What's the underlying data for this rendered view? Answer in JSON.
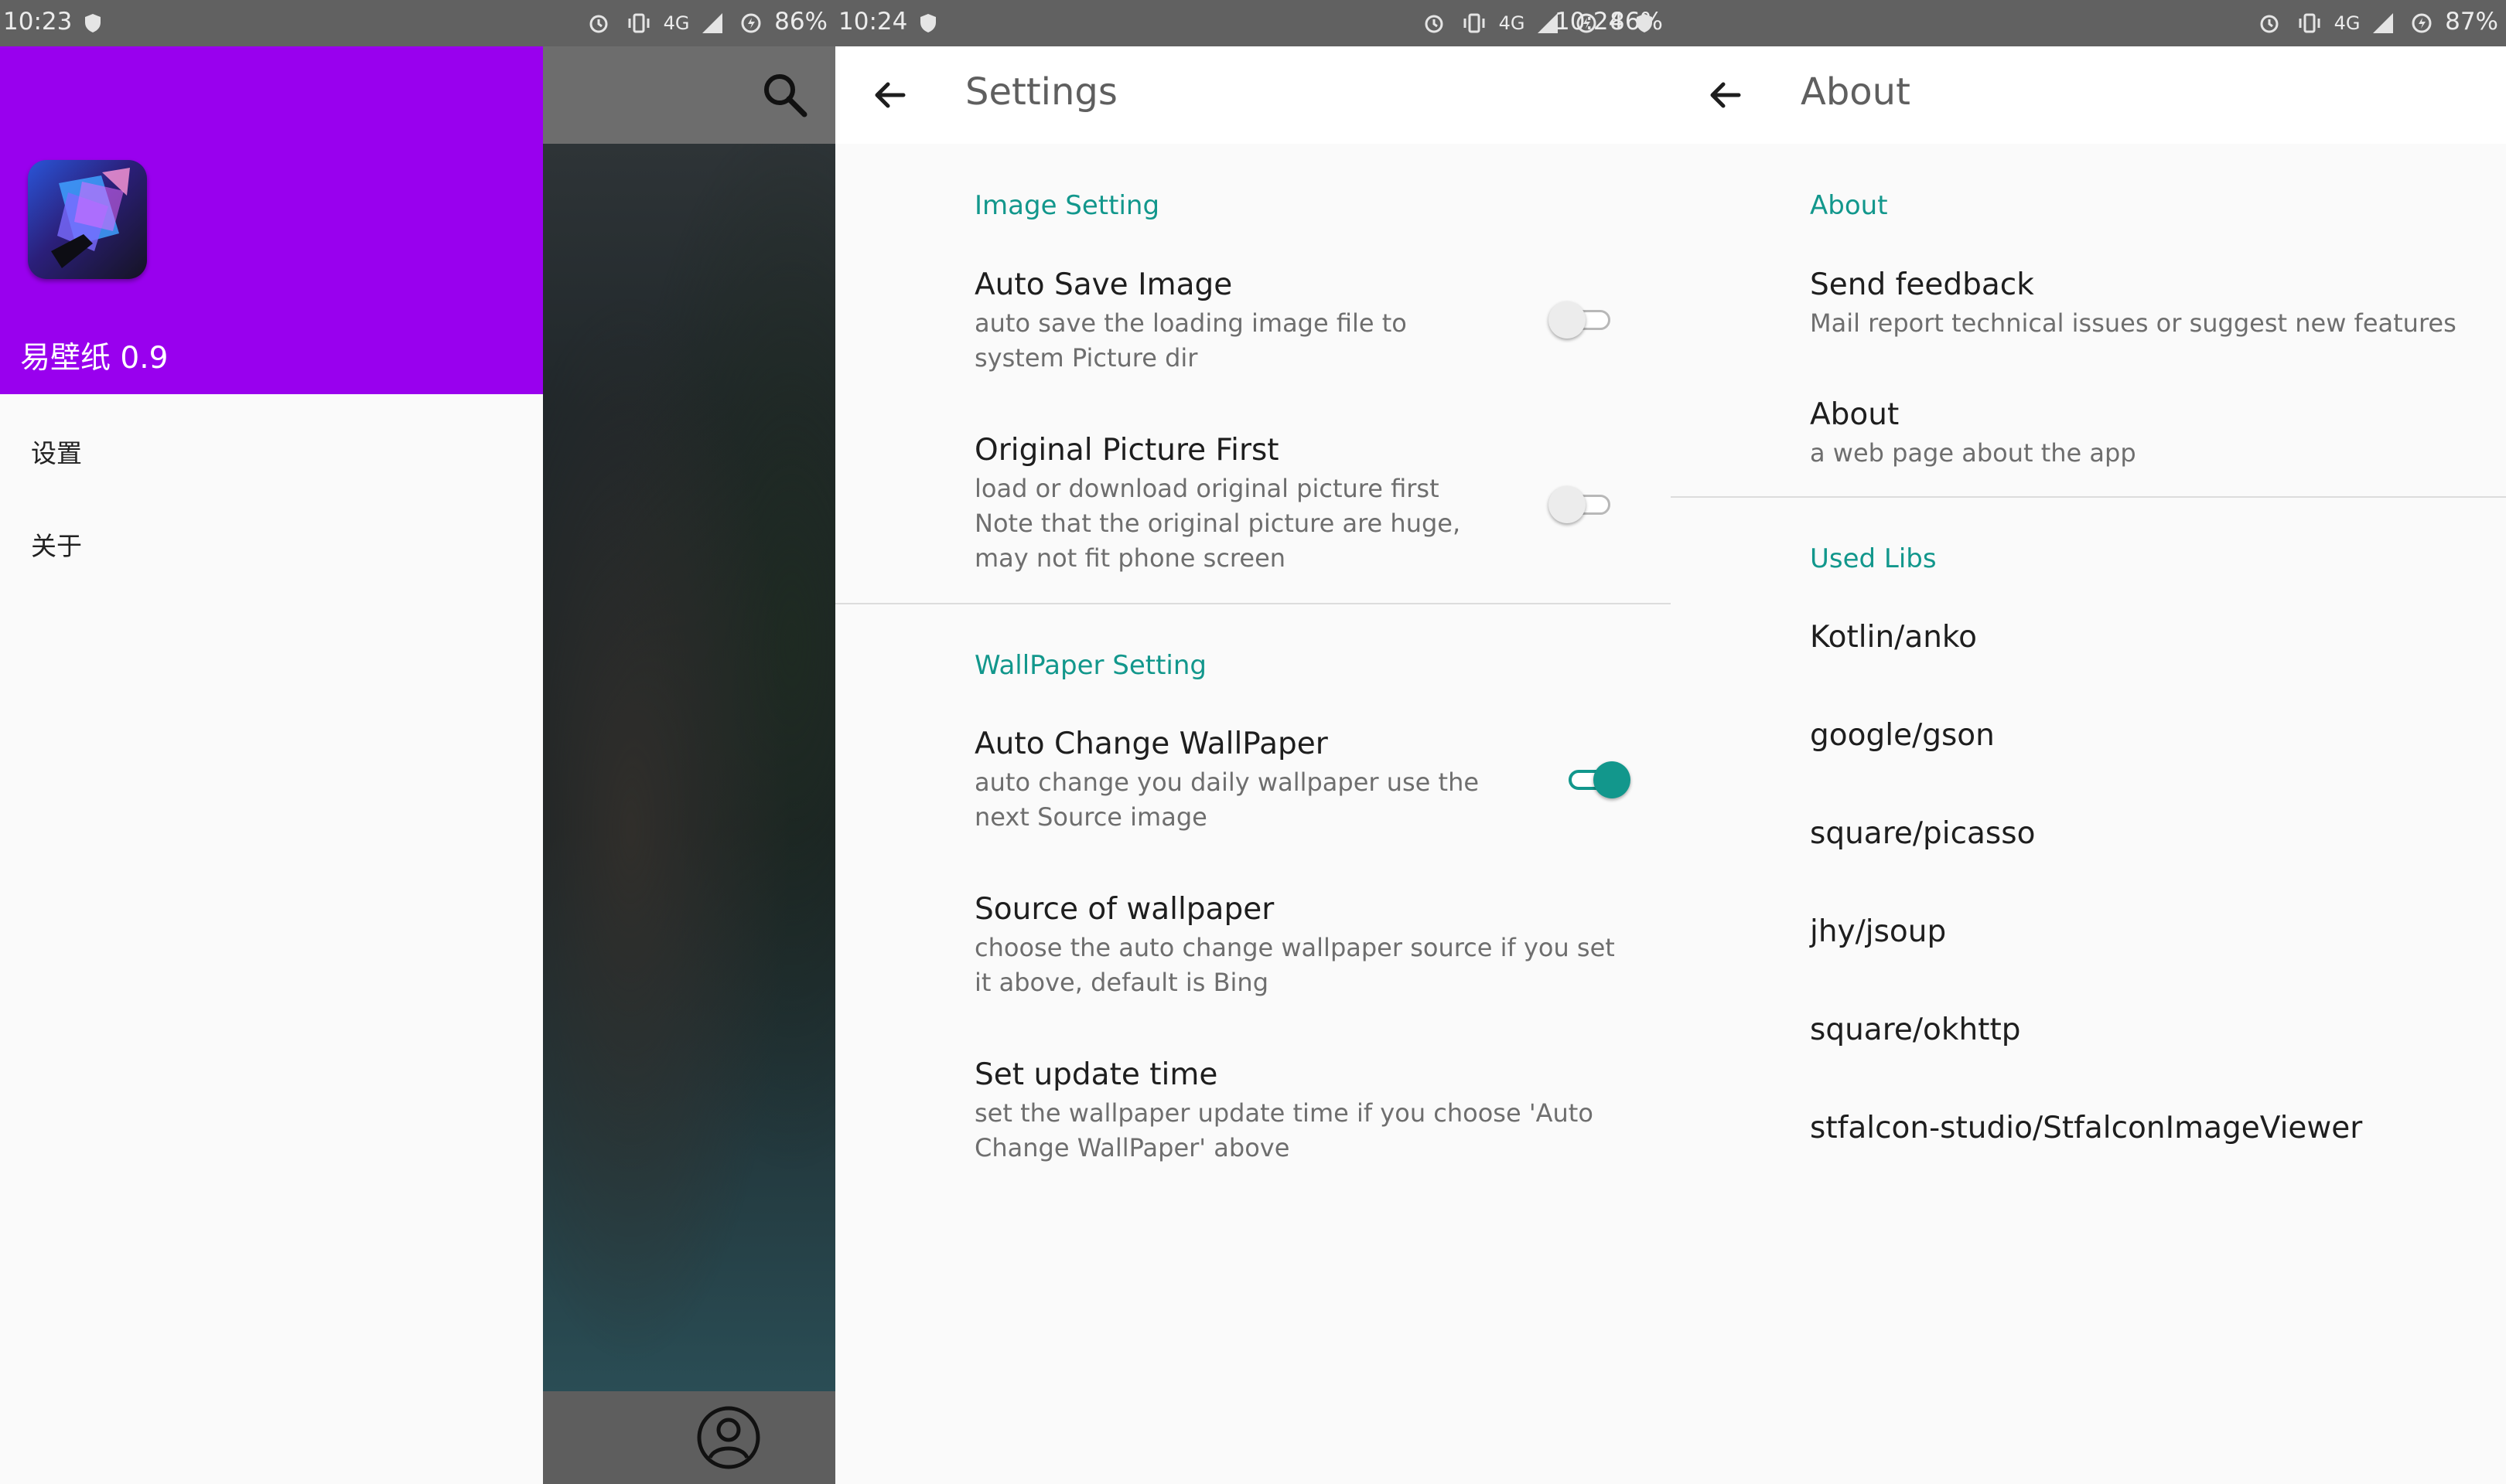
{
  "colors": {
    "accent": "#12978c",
    "drawer_header": "#9900ee",
    "statusbar": "#616161"
  },
  "panel1": {
    "status": {
      "time": "10:23",
      "battery": "86%"
    },
    "app_name": "易壁纸 0.9",
    "menu": [
      {
        "label": "设置"
      },
      {
        "label": "关于"
      }
    ],
    "icons": [
      "search-icon",
      "account-icon"
    ]
  },
  "panel2": {
    "status": {
      "time": "10:24",
      "battery": "86%"
    },
    "title": "Settings",
    "image_section": "Image Setting",
    "auto_save": {
      "title": "Auto Save Image",
      "summary_1": "auto save the loading image file to",
      "summary_2": "system Picture dir",
      "enabled": false
    },
    "original_first": {
      "title": "Original Picture First",
      "summary_1": "load or download original picture first",
      "summary_2": "Note that the original picture are huge,",
      "summary_3": "may not fit phone screen",
      "enabled": false
    },
    "wallpaper_section": "WallPaper Setting",
    "auto_change": {
      "title": "Auto Change WallPaper",
      "summary_1": "auto change you daily wallpaper use the",
      "summary_2": "next Source image",
      "enabled": true
    },
    "source": {
      "title": "Source of wallpaper",
      "summary_1": "choose the auto change wallpaper source if you set",
      "summary_2": "it above, default is Bing"
    },
    "update_time": {
      "title": "Set update time",
      "summary_1": "set the wallpaper update time if you choose 'Auto",
      "summary_2": "Change WallPaper' above"
    }
  },
  "panel3": {
    "status": {
      "time": "10:24",
      "battery": "87%"
    },
    "title": "About",
    "about_section": "About",
    "feedback": {
      "title": "Send feedback",
      "summary": "Mail report technical issues or suggest new features"
    },
    "about_item": {
      "title": "About",
      "summary": "a web page about the app"
    },
    "libs_section": "Used Libs",
    "libs": [
      "Kotlin/anko",
      "google/gson",
      "square/picasso",
      "jhy/jsoup",
      "square/okhttp",
      "stfalcon-studio/StfalconImageViewer"
    ]
  }
}
